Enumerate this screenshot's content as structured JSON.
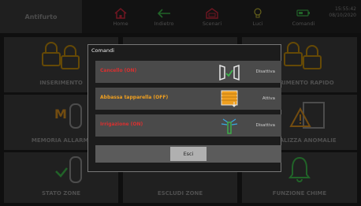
{
  "header": {
    "title": "Antifurto",
    "nav": [
      {
        "label": "Home",
        "icon": "home-icon"
      },
      {
        "label": "Indietro",
        "icon": "back-arrow-icon"
      },
      {
        "label": "Scenari",
        "icon": "scenari-icon"
      },
      {
        "label": "Luci",
        "icon": "lightbulb-icon"
      },
      {
        "label": "Comandi",
        "icon": "battery-toggle-icon"
      }
    ],
    "time": "15:55:42",
    "date": "08/10/2020"
  },
  "tiles": [
    {
      "label": "INSERIMENTO",
      "icon": "padlocks-icon"
    },
    {
      "label": "",
      "icon": ""
    },
    {
      "label": "INSERIMENTO RAPIDO",
      "icon": "padlocks-icon"
    },
    {
      "label": "MEMORIA ALLARMI",
      "icon": "memory-alarm-icon"
    },
    {
      "label": "",
      "icon": ""
    },
    {
      "label": "SEGNALIZZA ANOMALIE",
      "icon": "warning-icon"
    },
    {
      "label": "STATO ZONE",
      "icon": "zone-status-icon"
    },
    {
      "label": "ESCLUDI ZONE",
      "icon": "zone-exclude-icon"
    },
    {
      "label": "FUNZIONE CHIME",
      "icon": "bell-icon"
    }
  ],
  "modal": {
    "title": "Comandi",
    "rows": [
      {
        "label": "Cancello (ON)",
        "color": "#d93030",
        "action": "Disattiva",
        "icon": "gate-icon"
      },
      {
        "label": "Abbassa tapparella (OFF)",
        "color": "#f0a020",
        "action": "Attiva",
        "icon": "shutter-icon"
      },
      {
        "label": "Irrigazione (ON)",
        "color": "#d93030",
        "action": "Disattiva",
        "icon": "sprinkler-icon"
      }
    ],
    "exit_label": "Esci"
  },
  "colors": {
    "accent_red": "#c8283c",
    "accent_green": "#3cb44a",
    "accent_yellow": "#f0a020",
    "icon_gold": "#b8860b"
  }
}
